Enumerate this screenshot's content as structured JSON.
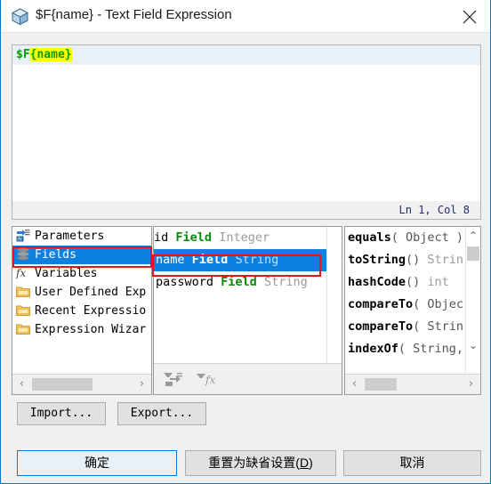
{
  "window": {
    "title": "$F{name} - Text Field Expression",
    "icon": "cube-icon",
    "close_label": "✕",
    "border_color": "#0078d7"
  },
  "editor": {
    "tokens": [
      {
        "text": "$F",
        "style": "function"
      },
      {
        "text": "{name}",
        "style": "highlight"
      }
    ],
    "full_text": "$F{name}",
    "highlight_color": "#ffff00",
    "token_color": "#00a000",
    "line_background": "#e8f1f8"
  },
  "status": {
    "position": "Ln 1, Col 8"
  },
  "tree": {
    "items": [
      {
        "label": "Parameters",
        "icon": "parameters-icon",
        "selected": false
      },
      {
        "label": "Fields",
        "icon": "fields-icon",
        "selected": true
      },
      {
        "label": "Variables",
        "icon": "variables-fx-icon",
        "selected": false
      },
      {
        "label": "User Defined Exp",
        "icon": "folder-icon",
        "selected": false
      },
      {
        "label": "Recent Expressio",
        "icon": "folder-icon",
        "selected": false
      },
      {
        "label": "Expression Wizar",
        "icon": "folder-icon",
        "selected": false
      }
    ],
    "scrollbar": {
      "left_arrow": "‹",
      "right_arrow": "›"
    }
  },
  "fields": {
    "rows": [
      {
        "name": "id",
        "kind": "Field",
        "type": "Integer",
        "selected": false
      },
      {
        "name": "name",
        "kind": "Field",
        "type": "String",
        "selected": true
      },
      {
        "name": "password",
        "kind": "Field",
        "type": "String",
        "selected": false
      }
    ],
    "tools": [
      {
        "icon": "filter-list-icon"
      },
      {
        "icon": "filter-fx-icon"
      }
    ],
    "scrollbar": {
      "left_arrow": "‹",
      "right_arrow": "›"
    }
  },
  "methods": {
    "rows": [
      {
        "name": "equals",
        "args": "( Object )",
        "ret": ""
      },
      {
        "name": "toString",
        "args": "()",
        "ret": " Strin"
      },
      {
        "name": "hashCode",
        "args": "()",
        "ret": " int"
      },
      {
        "name": "compareTo",
        "args": "( Objec",
        "ret": ""
      },
      {
        "name": "compareTo",
        "args": "( Strin",
        "ret": ""
      },
      {
        "name": "indexOf",
        "args": "( String,",
        "ret": ""
      }
    ],
    "scrollbar": {
      "up_arrow": "⌃",
      "down_arrow": "⌄",
      "left_arrow": "‹",
      "right_arrow": "›"
    }
  },
  "toolbar": {
    "import_label": "Import...",
    "export_label": "Export..."
  },
  "footer": {
    "ok_label": "确定",
    "reset_label": "重置为缺省设置(D)",
    "reset_mnemonic": "D",
    "cancel_label": "取消"
  },
  "annotations": [
    {
      "name": "fields-highlight",
      "color": "#ee1111"
    },
    {
      "name": "name-row-highlight",
      "color": "#ee1111"
    }
  ]
}
